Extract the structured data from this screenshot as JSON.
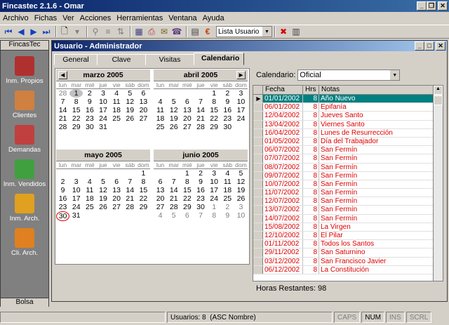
{
  "window": {
    "title": "Fincastec 2.1.6 - Omar"
  },
  "menu": [
    "Archivo",
    "Fichas",
    "Ver",
    "Acciones",
    "Herramientas",
    "Ventana",
    "Ayuda"
  ],
  "toolbar": {
    "dropdown_value": "Lista Usuario"
  },
  "sidebar": {
    "header": "FincasTec",
    "footer": "Bolsa",
    "items": [
      {
        "label": "Inm. Propios",
        "icon": "house-icon",
        "color": "#b03030"
      },
      {
        "label": "Clientes",
        "icon": "hands-icon",
        "color": "#d08040"
      },
      {
        "label": "Demandas",
        "icon": "document-icon",
        "color": "#c04040"
      },
      {
        "label": "Inm. Vendidos",
        "icon": "house-green-icon",
        "color": "#40a040"
      },
      {
        "label": "Inm. Arch.",
        "icon": "archive-house-icon",
        "color": "#e0a020"
      },
      {
        "label": "Cli. Arch.",
        "icon": "archive-box-icon",
        "color": "#e08020"
      }
    ]
  },
  "child": {
    "title": "Usuario - Administrador"
  },
  "tabs": [
    "General",
    "Clave",
    "Visitas",
    "Calendario"
  ],
  "dow": [
    "lun",
    "mar",
    "mié",
    "jue",
    "vie",
    "sáb",
    "dom"
  ],
  "months": [
    {
      "name": "marzo 2005",
      "days": [
        "28",
        "1",
        "2",
        "3",
        "4",
        "5",
        "6",
        "7",
        "8",
        "9",
        "10",
        "11",
        "12",
        "13",
        "14",
        "15",
        "16",
        "17",
        "18",
        "19",
        "20",
        "21",
        "22",
        "23",
        "24",
        "25",
        "26",
        "27",
        "28",
        "29",
        "30",
        "31",
        "",
        "",
        ""
      ],
      "other": [
        0
      ]
    },
    {
      "name": "abril 2005",
      "days": [
        "",
        "",
        "",
        "",
        "1",
        "2",
        "3",
        "4",
        "5",
        "6",
        "7",
        "8",
        "9",
        "10",
        "11",
        "12",
        "13",
        "14",
        "15",
        "16",
        "17",
        "18",
        "19",
        "20",
        "21",
        "22",
        "23",
        "24",
        "25",
        "26",
        "27",
        "28",
        "29",
        "30",
        ""
      ],
      "other": []
    },
    {
      "name": "mayo 2005",
      "days": [
        "",
        "",
        "",
        "",
        "",
        "",
        "1",
        "2",
        "3",
        "4",
        "5",
        "6",
        "7",
        "8",
        "9",
        "10",
        "11",
        "12",
        "13",
        "14",
        "15",
        "16",
        "17",
        "18",
        "19",
        "20",
        "21",
        "22",
        "23",
        "24",
        "25",
        "26",
        "27",
        "28",
        "29",
        "30",
        "31",
        "",
        "",
        "",
        "",
        ""
      ],
      "other": []
    },
    {
      "name": "junio 2005",
      "days": [
        "",
        "",
        "1",
        "2",
        "3",
        "4",
        "5",
        "6",
        "7",
        "8",
        "9",
        "10",
        "11",
        "12",
        "13",
        "14",
        "15",
        "16",
        "17",
        "18",
        "19",
        "20",
        "21",
        "22",
        "23",
        "24",
        "25",
        "26",
        "27",
        "28",
        "29",
        "30",
        "1",
        "2",
        "3",
        "4",
        "5",
        "6",
        "7",
        "8",
        "9",
        "10"
      ],
      "other": [
        32,
        33,
        34,
        35,
        36,
        37,
        38,
        39,
        40,
        41
      ]
    }
  ],
  "calendar": {
    "label": "Calendario:",
    "value": "Oficial"
  },
  "grid": {
    "headers": [
      "Fecha",
      "Hrs",
      "Notas"
    ],
    "rows": [
      [
        "01/01/2002",
        "8",
        "Año Nuevo"
      ],
      [
        "06/01/2002",
        "8",
        "Epifanía"
      ],
      [
        "12/04/2002",
        "8",
        "Jueves Santo"
      ],
      [
        "13/04/2002",
        "8",
        "Viernes Santo"
      ],
      [
        "16/04/2002",
        "8",
        "Lunes de Resurrección"
      ],
      [
        "01/05/2002",
        "8",
        "Día del Trabajador"
      ],
      [
        "06/07/2002",
        "8",
        "San Fermín"
      ],
      [
        "07/07/2002",
        "8",
        "San Fermín"
      ],
      [
        "08/07/2002",
        "8",
        "San Fermín"
      ],
      [
        "09/07/2002",
        "8",
        "San Fermín"
      ],
      [
        "10/07/2002",
        "8",
        "San Fermín"
      ],
      [
        "11/07/2002",
        "8",
        "San Fermín"
      ],
      [
        "12/07/2002",
        "8",
        "San Fermín"
      ],
      [
        "13/07/2002",
        "8",
        "San Fermín"
      ],
      [
        "14/07/2002",
        "8",
        "San Fermín"
      ],
      [
        "15/08/2002",
        "8",
        "La Virgen"
      ],
      [
        "12/10/2002",
        "8",
        "El Pilar"
      ],
      [
        "01/11/2002",
        "8",
        "Todos los Santos"
      ],
      [
        "29/11/2002",
        "8",
        "San Saturnino"
      ],
      [
        "03/12/2002",
        "8",
        "San Francisco Javier"
      ],
      [
        "06/12/2002",
        "8",
        "La Constitución"
      ]
    ]
  },
  "remaining": "Horas Restantes: 98",
  "status": {
    "users": "Usuarios: 8",
    "order": "(ASC Nombre)",
    "caps": "CAPS",
    "num": "NUM",
    "ins": "INS",
    "scrl": "SCRL"
  }
}
